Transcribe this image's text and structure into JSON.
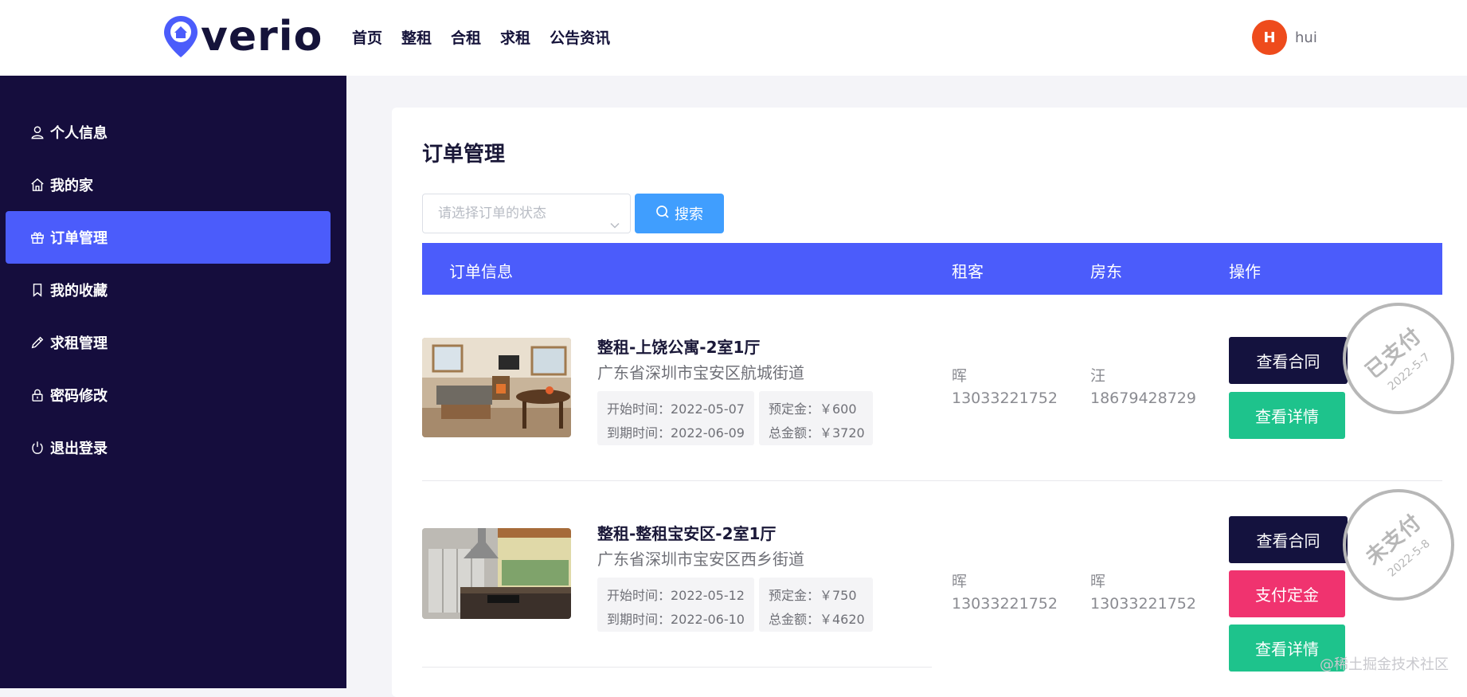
{
  "header": {
    "logo_text": "verio",
    "nav": [
      "首页",
      "整租",
      "合租",
      "求租",
      "公告资讯"
    ],
    "user": {
      "initial": "H",
      "name": "hui",
      "avatar_color": "#ee4b1c"
    }
  },
  "sidebar": {
    "items": [
      {
        "label": "个人信息",
        "icon": "user-icon"
      },
      {
        "label": "我的家",
        "icon": "home-icon"
      },
      {
        "label": "订单管理",
        "icon": "gift-icon",
        "active": true
      },
      {
        "label": "我的收藏",
        "icon": "bookmark-icon"
      },
      {
        "label": "求租管理",
        "icon": "pencil-icon"
      },
      {
        "label": "密码修改",
        "icon": "lock-icon"
      },
      {
        "label": "退出登录",
        "icon": "power-icon"
      }
    ]
  },
  "main": {
    "title": "订单管理",
    "filter_placeholder": "请选择订单的状态",
    "search_label": "搜索",
    "columns": [
      "订单信息",
      "租客",
      "房东",
      "操作"
    ],
    "orders": [
      {
        "title": "整租-上饶公寓-2室1厅",
        "address": "广东省深圳市宝安区航城街道",
        "start": "开始时间：2022-05-07",
        "end": "到期时间：2022-06-09",
        "deposit": "预定金：￥600",
        "total": "总金额：￥3720",
        "tenant_name": "晖",
        "tenant_phone": "13033221752",
        "landlord_name": "汪",
        "landlord_phone": "18679428729",
        "actions": [
          "查看合同",
          "查看详情"
        ],
        "stamp": "已支付",
        "stamp_date": "2022-5-7"
      },
      {
        "title": "整租-整租宝安区-2室1厅",
        "address": "广东省深圳市宝安区西乡街道",
        "start": "开始时间：2022-05-12",
        "end": "到期时间：2022-06-10",
        "deposit": "预定金：￥750",
        "total": "总金额：￥4620",
        "tenant_name": "晖",
        "tenant_phone": "13033221752",
        "landlord_name": "晖",
        "landlord_phone": "13033221752",
        "actions": [
          "查看合同",
          "支付定金",
          "查看详情"
        ],
        "stamp": "未支付",
        "stamp_date": "2022-5-8"
      }
    ]
  },
  "watermark": "@稀土掘金技术社区",
  "colors": {
    "sidebar_bg": "#150d3d",
    "accent": "#4b5cfb",
    "search_btn": "#409efe",
    "btn_dark": "#14123e",
    "btn_green": "#1ec38c",
    "btn_pink": "#f0336f"
  }
}
